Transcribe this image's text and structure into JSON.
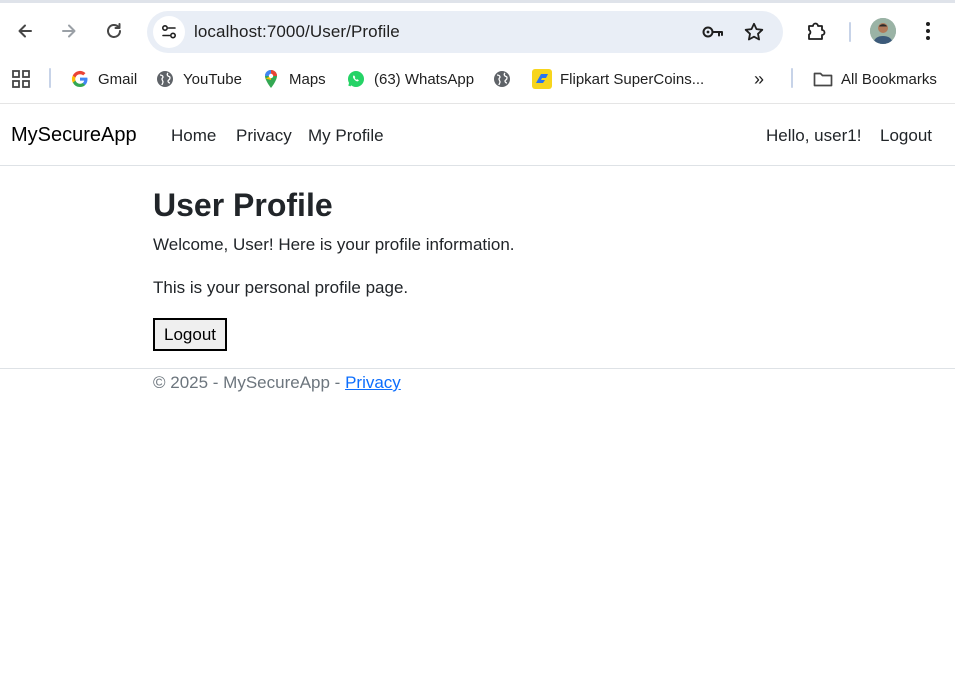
{
  "browser": {
    "url": "localhost:7000/User/Profile",
    "bookmarks": [
      {
        "label": "Gmail",
        "icon": "google-icon"
      },
      {
        "label": "YouTube",
        "icon": "globe-icon"
      },
      {
        "label": "Maps",
        "icon": "maps-pin-icon"
      },
      {
        "label": "(63) WhatsApp",
        "icon": "whatsapp-icon"
      },
      {
        "label": "",
        "icon": "globe-icon"
      },
      {
        "label": "Flipkart SuperCoins...",
        "icon": "flipkart-icon"
      }
    ],
    "overflow_label": "»",
    "all_bookmarks_label": "All Bookmarks"
  },
  "app": {
    "brand": "MySecureApp",
    "nav": {
      "home": "Home",
      "privacy": "Privacy",
      "profile": "My Profile",
      "hello": "Hello, user1!",
      "logout": "Logout"
    },
    "main": {
      "title": "User Profile",
      "welcome": "Welcome, User! Here is your profile information.",
      "personal": "This is your personal profile page.",
      "logout_button": "Logout"
    },
    "footer": {
      "text": "© 2025 - MySecureApp - ",
      "privacy_link": "Privacy"
    }
  },
  "colors": {
    "link": "#0d6efd",
    "text": "#212529",
    "omnibox": "#e9eef6"
  }
}
